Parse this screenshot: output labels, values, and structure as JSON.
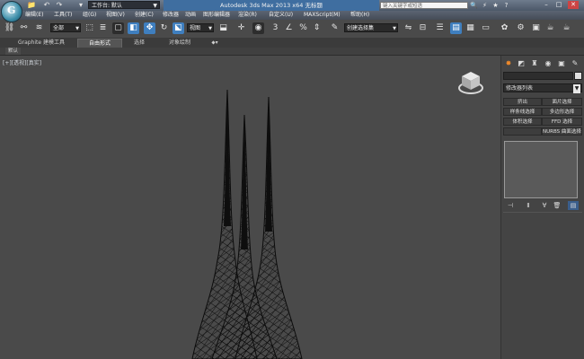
{
  "titlebar": {
    "logo_letter": "G",
    "quick_access": [
      "📁",
      "↶",
      "↷",
      "▾"
    ],
    "workspace_label": "工作台: 默认",
    "title": "Autodesk 3ds Max  2013 x64    无标题",
    "search_placeholder": "键入关键字或短语",
    "help_icons": [
      "🔍",
      "⚡",
      "★",
      "?"
    ],
    "window_controls": [
      "–",
      "□",
      "✕"
    ]
  },
  "menu": {
    "items": [
      "编辑(E)",
      "工具(T)",
      "组(G)",
      "视图(V)",
      "创建(C)",
      "修改器",
      "动画",
      "图形编辑器",
      "渲染(R)",
      "自定义(U)",
      "MAXScript(M)",
      "帮助(H)"
    ]
  },
  "toolbar": {
    "selection_filter": "全部",
    "ref_coord": "视图",
    "named_set": "创建选择集"
  },
  "ribbon": {
    "tabs": [
      "Graphite 建模工具",
      "自由形式",
      "选择",
      "对象绘制"
    ],
    "active": "自由形式",
    "panel_label": "默认"
  },
  "viewport": {
    "label": "[+][透视][真实]"
  },
  "command_panel": {
    "modifier_list": "修改器列表",
    "buttons": [
      [
        "挤出",
        "面片选择"
      ],
      [
        "样条线选择",
        "多边形选择"
      ],
      [
        "体积选择",
        "FFD 选择"
      ],
      [
        "",
        "NURBS 曲面选择"
      ]
    ]
  }
}
